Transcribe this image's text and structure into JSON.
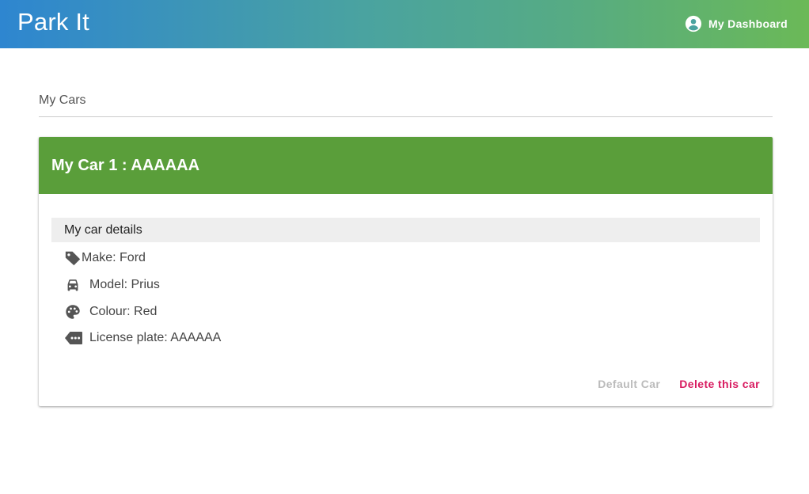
{
  "app": {
    "title": "Park It"
  },
  "header": {
    "dashboard_label": "My Dashboard",
    "dashboard_icon": "account-circle-icon"
  },
  "section": {
    "title": "My Cars"
  },
  "car_card": {
    "title": "My Car 1 : AAAAAA",
    "header_color": "#5a9e3a",
    "details_heading": "My car details",
    "details": [
      {
        "icon": "tag-icon",
        "text": "Make: Ford"
      },
      {
        "icon": "car-icon",
        "text": "Model: Prius"
      },
      {
        "icon": "palette-icon",
        "text": "Colour: Red"
      },
      {
        "icon": "license-plate-icon",
        "text": "License plate: AAAAAA"
      }
    ],
    "actions": {
      "default_label": "Default Car",
      "delete_label": "Delete this car",
      "delete_color": "#d81b60"
    }
  }
}
